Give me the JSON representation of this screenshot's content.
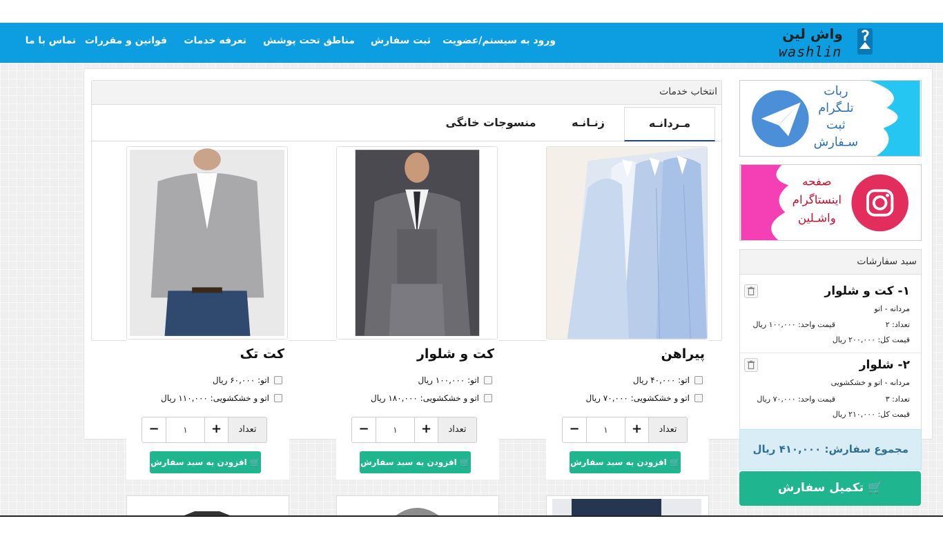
{
  "logo": {
    "text": "واش لین",
    "sub": "washlin"
  },
  "nav": {
    "login": "ورود به سیستم/عضویت",
    "order": "ثبت سفارش",
    "areas": "مناطق تحت پوشش",
    "prices": "تعرفه خدمات",
    "rules": "قوانین و مقررات",
    "contact": "تماس با ما"
  },
  "services": {
    "title": "انتخاب خدمات",
    "tabs": [
      "مـردانـه",
      "زنـانـه",
      "منسوجات خانگی"
    ],
    "active_tab": 0,
    "qty_label": "تعداد",
    "add_label": "افزودن به سبد سفارش",
    "products": [
      {
        "name": "پیراهن",
        "opt1": "اتو: ۴۰,۰۰۰ ریال",
        "opt2": "اتو و خشکشویی: ۷۰,۰۰۰ ریال",
        "qty": "۱"
      },
      {
        "name": "کت و شلوار",
        "opt1": "اتو: ۱۰۰,۰۰۰ ریال",
        "opt2": "اتو و خشکشویی: ۱۸۰,۰۰۰ ریال",
        "qty": "۱"
      },
      {
        "name": "کت تک",
        "opt1": "اتو: ۶۰,۰۰۰ ریال",
        "opt2": "اتو و خشکشویی: ۱۱۰,۰۰۰ ریال",
        "qty": "۱"
      }
    ]
  },
  "banners": {
    "telegram": [
      "ربات",
      "تلـگرام",
      "ثبت",
      "سـفارش"
    ],
    "instagram": [
      "صفحه",
      "اینستاگرام",
      "واشـلین"
    ]
  },
  "cart": {
    "title": "سبد سفارشات",
    "items": [
      {
        "title": "۱- کت و شلوار",
        "service": "مردانه - اتو",
        "unit_price": "قیمت واحد: ۱۰۰,۰۰۰ ریال",
        "qty": "تعداد: ۲",
        "total": "قیمت کل: ۲۰۰,۰۰۰ ریال"
      },
      {
        "title": "۲- شلوار",
        "service": "مردانه - اتو و خشکشویی",
        "unit_price": "قیمت واحد: ۷۰,۰۰۰ ریال",
        "qty": "تعداد: ۳",
        "total": "قیمت کل: ۲۱۰,۰۰۰ ریال"
      }
    ],
    "sum": "مجموع سفارش: ۴۱۰,۰۰۰ ریال",
    "checkout": "تکمیل سفارش"
  },
  "colors": {
    "nav": "#0c9ee0",
    "accent": "#1fb58f",
    "total_bg": "#d9edf7",
    "active_tab": "#1e3fa0"
  }
}
